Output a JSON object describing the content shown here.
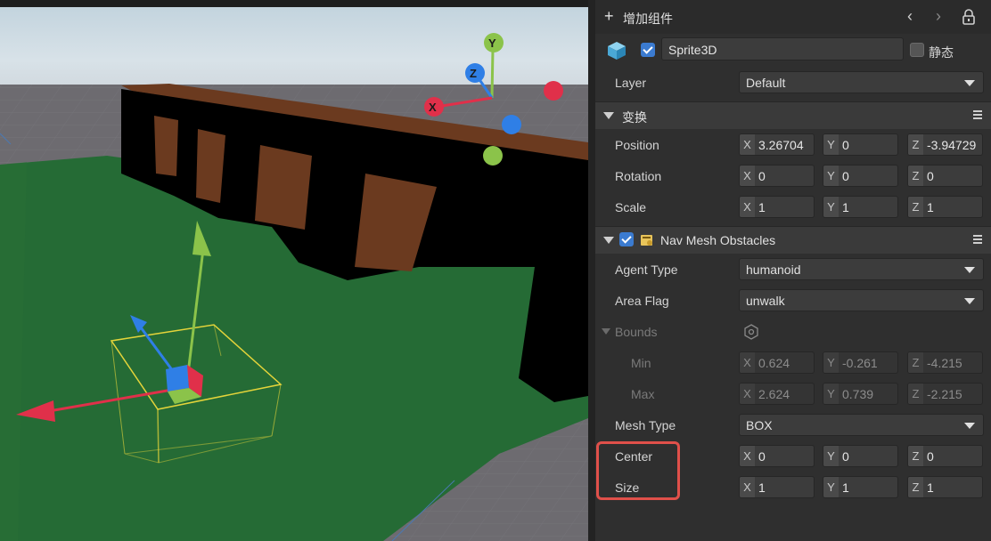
{
  "header": {
    "add_component": "增加组件"
  },
  "object": {
    "name": "Sprite3D",
    "static_label": "静态",
    "enabled": true,
    "static": false
  },
  "layer": {
    "label": "Layer",
    "value": "Default"
  },
  "transform": {
    "title": "变换",
    "position": {
      "label": "Position",
      "x": "3.26704",
      "y": "0",
      "z": "-3.94729"
    },
    "rotation": {
      "label": "Rotation",
      "x": "0",
      "y": "0",
      "z": "0"
    },
    "scale": {
      "label": "Scale",
      "x": "1",
      "y": "1",
      "z": "1"
    }
  },
  "nav": {
    "title": "Nav Mesh Obstacles",
    "agent_type": {
      "label": "Agent Type",
      "value": "humanoid"
    },
    "area_flag": {
      "label": "Area Flag",
      "value": "unwalk"
    },
    "bounds_label": "Bounds",
    "min": {
      "label": "Min",
      "x": "0.624",
      "y": "-0.261",
      "z": "-4.215"
    },
    "max": {
      "label": "Max",
      "x": "2.624",
      "y": "0.739",
      "z": "-2.215"
    },
    "mesh_type": {
      "label": "Mesh Type",
      "value": "BOX"
    },
    "center": {
      "label": "Center",
      "x": "0",
      "y": "0",
      "z": "0"
    },
    "size": {
      "label": "Size",
      "x": "1",
      "y": "1",
      "z": "1"
    }
  },
  "axis_letters": {
    "x": "X",
    "y": "Y",
    "z": "Z"
  },
  "colors": {
    "highlight": "#e0504a",
    "accent": "#3b7bd0",
    "ground": "#256b35",
    "wall": "#6b3a1f"
  }
}
